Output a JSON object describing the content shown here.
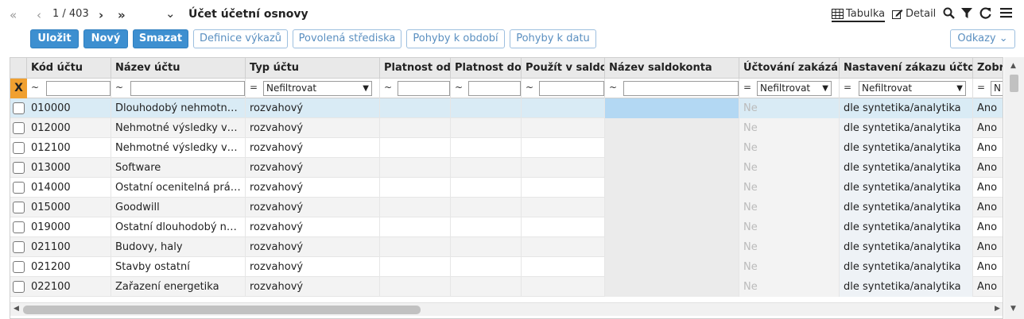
{
  "nav": {
    "first_icon": "«",
    "prev_icon": "‹",
    "record_pos": "1 / 403",
    "next_icon": "›",
    "last_icon": "»",
    "dropdown_icon": "⌄"
  },
  "title": "Účet účetní osnovy",
  "views": {
    "table_label": "Tabulka",
    "detail_label": "Detail"
  },
  "toolbar": {
    "save": "Uložit",
    "new": "Nový",
    "delete": "Smazat",
    "report_def": "Definice výkazů",
    "allowed_centers": "Povolená střediska",
    "moves_period": "Pohyby k období",
    "moves_date": "Pohyby k datu",
    "links": "Odkazy ⌄"
  },
  "columns": {
    "code": "Kód účtu",
    "name": "Název účtu",
    "type": "Typ účtu",
    "valid_from": "Platnost od",
    "valid_to": "Platnost do",
    "use_saldo": "Použít v saldokontě",
    "saldo_name": "Název saldokonta",
    "order_locked": "Účtování zakázáno",
    "order_setting": "Nastavení zákazu účtování",
    "display": "Zobrazit"
  },
  "filters": {
    "clear": "X",
    "tilde": "~",
    "eq": "=",
    "none": "Nefiltrovat",
    "short": "N"
  },
  "rows": [
    {
      "code": "010000",
      "name": "Dlouhodobý nehmotný majetek",
      "type": "rozvahový",
      "locked": "Ne",
      "setting": "dle syntetika/analytika",
      "display": "Ano"
    },
    {
      "code": "012000",
      "name": "Nehmotné výsledky vývoje",
      "type": "rozvahový",
      "locked": "Ne",
      "setting": "dle syntetika/analytika",
      "display": "Ano"
    },
    {
      "code": "012100",
      "name": "Nehmotné výsledky výzkumu",
      "type": "rozvahový",
      "locked": "Ne",
      "setting": "dle syntetika/analytika",
      "display": "Ano"
    },
    {
      "code": "013000",
      "name": "Software",
      "type": "rozvahový",
      "locked": "Ne",
      "setting": "dle syntetika/analytika",
      "display": "Ano"
    },
    {
      "code": "014000",
      "name": "Ostatní ocenitelná práva",
      "type": "rozvahový",
      "locked": "Ne",
      "setting": "dle syntetika/analytika",
      "display": "Ano"
    },
    {
      "code": "015000",
      "name": "Goodwill",
      "type": "rozvahový",
      "locked": "Ne",
      "setting": "dle syntetika/analytika",
      "display": "Ano"
    },
    {
      "code": "019000",
      "name": "Ostatní dlouhodobý nehmotný majetek",
      "type": "rozvahový",
      "locked": "Ne",
      "setting": "dle syntetika/analytika",
      "display": "Ano"
    },
    {
      "code": "021100",
      "name": "Budovy, haly",
      "type": "rozvahový",
      "locked": "Ne",
      "setting": "dle syntetika/analytika",
      "display": "Ano"
    },
    {
      "code": "021200",
      "name": "Stavby ostatní",
      "type": "rozvahový",
      "locked": "Ne",
      "setting": "dle syntetika/analytika",
      "display": "Ano"
    },
    {
      "code": "022100",
      "name": "Zařazení energetika",
      "type": "rozvahový",
      "locked": "Ne",
      "setting": "dle syntetika/analytika",
      "display": "Ano"
    }
  ]
}
